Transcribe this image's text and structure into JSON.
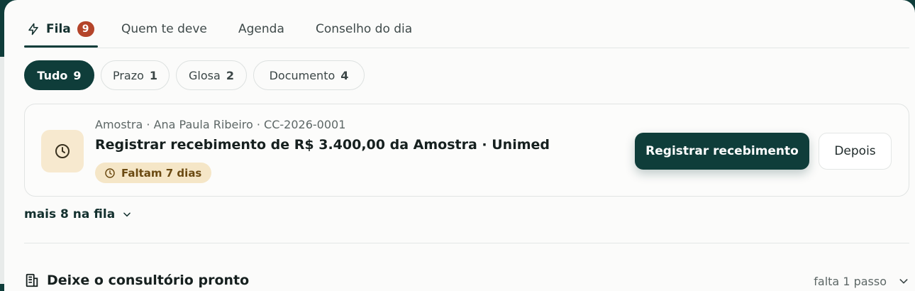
{
  "tabs": [
    {
      "label": "Fila",
      "badge": "9",
      "active": true
    },
    {
      "label": "Quem te deve"
    },
    {
      "label": "Agenda"
    },
    {
      "label": "Conselho do dia"
    }
  ],
  "filters": [
    {
      "label": "Tudo",
      "count": "9",
      "active": true
    },
    {
      "label": "Prazo",
      "count": "1"
    },
    {
      "label": "Glosa",
      "count": "2"
    },
    {
      "label": "Documento",
      "count": "4"
    }
  ],
  "task": {
    "icon": "clock-icon",
    "meta": "Amostra · Ana Paula Ribeiro · CC-2026-0001",
    "title": "Registrar recebimento de R$ 3.400,00 da Amostra · Unimed",
    "deadline": "Faltam 7 dias",
    "primary_action": "Registrar recebimento",
    "secondary_action": "Depois"
  },
  "queue_more": "mais 8 na fila",
  "section": {
    "title": "Deixe o consultório pronto",
    "status": "falta 1 passo"
  },
  "colors": {
    "brand": "#0f3d3a",
    "badge": "#b4442a",
    "deadline_bg": "#f5e6c7",
    "icon_bg": "#f7e9cf"
  }
}
